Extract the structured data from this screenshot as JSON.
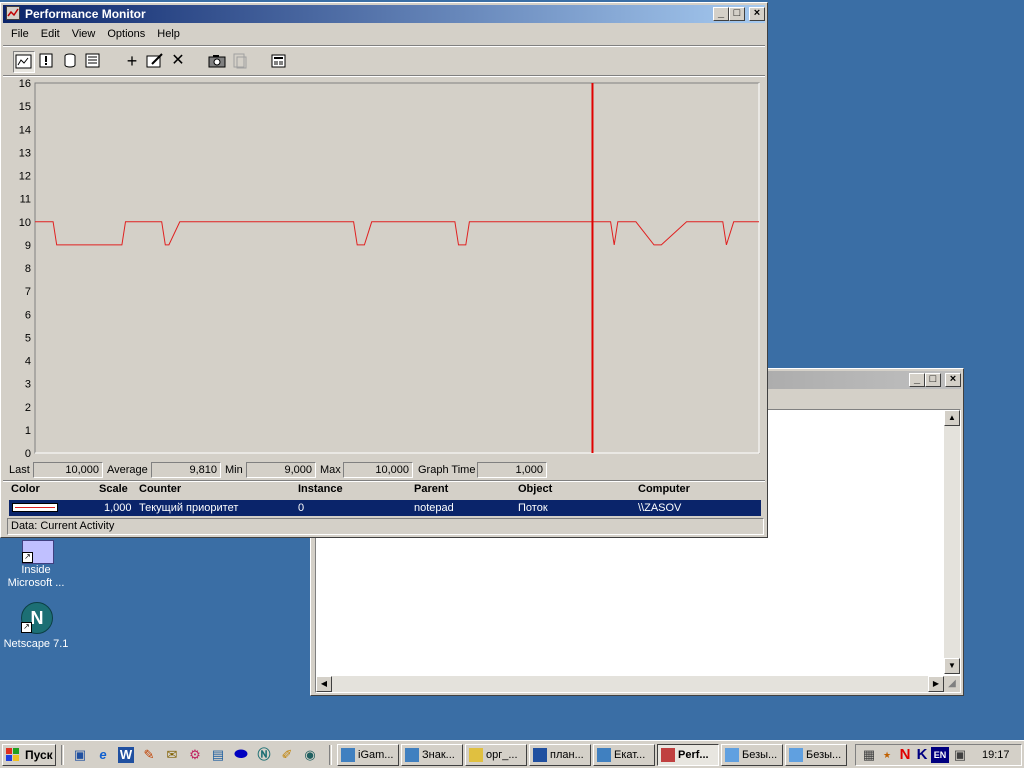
{
  "perfmon": {
    "title": "Performance Monitor",
    "menu": [
      "File",
      "Edit",
      "View",
      "Options",
      "Help"
    ],
    "toolbar_icons": [
      "chart-view-icon",
      "alert-view-icon",
      "log-view-icon",
      "report-view-icon",
      "add-counter-icon",
      "edit-counter-icon",
      "delete-counter-icon",
      "snapshot-icon",
      "update-data-icon",
      "options-icon"
    ],
    "stats": {
      "last_label": "Last",
      "last_value": "10,000",
      "avg_label": "Average",
      "avg_value": "9,810",
      "min_label": "Min",
      "min_value": "9,000",
      "max_label": "Max",
      "max_value": "10,000",
      "time_label": "Graph Time",
      "time_value": "1,000"
    },
    "legend_headers": {
      "color": "Color",
      "scale": "Scale",
      "counter": "Counter",
      "instance": "Instance",
      "parent": "Parent",
      "object": "Object",
      "computer": "Computer"
    },
    "legend_row": {
      "scale": "1,000",
      "counter": "Текущий приоритет",
      "instance": "0",
      "parent": "notepad",
      "object": "Поток",
      "computer": "\\\\ZASOV"
    },
    "status": "Data: Current Activity"
  },
  "chart_data": {
    "type": "line",
    "ylim": [
      0,
      16
    ],
    "yticks": [
      "0",
      "1",
      "2",
      "3",
      "4",
      "5",
      "6",
      "7",
      "8",
      "9",
      "10",
      "11",
      "12",
      "13",
      "14",
      "15",
      "16"
    ],
    "grid": false,
    "line_color": "#e02020",
    "time_bar_position": 0.77,
    "series": [
      {
        "x": [
          0,
          0.025,
          0.03,
          0.12,
          0.125,
          0.175,
          0.18,
          0.185,
          0.2,
          0.205,
          0.44,
          0.445,
          0.455,
          0.465,
          0.58,
          0.585,
          0.595,
          0.6,
          0.77,
          0.795,
          0.8,
          0.805,
          0.83,
          0.855,
          0.865,
          0.9,
          0.95,
          0.955,
          0.965,
          1.0
        ],
        "values": [
          10,
          10,
          9,
          9,
          10,
          10,
          9,
          9,
          10,
          10,
          10,
          9,
          9,
          10,
          10,
          9,
          9,
          10,
          10,
          10,
          9,
          10,
          10,
          9,
          9,
          10,
          10,
          9,
          10,
          10
        ]
      }
    ]
  },
  "notepad": {
    "title": ""
  },
  "desktop": {
    "icon1_label_line1": "Inside",
    "icon1_label_line2": "Microsoft ...",
    "icon2_label": "Netscape 7.1"
  },
  "taskbar": {
    "start_label": "Пуск",
    "tasks": [
      "iGam...",
      "Знак...",
      "орг_...",
      "план...",
      "Екат...",
      "Perf...",
      "Безы...",
      "Безы..."
    ],
    "active_task": 5,
    "lang": "EN",
    "clock": "19:17"
  },
  "colors": {
    "desktop": "#3a6ea5",
    "face": "#d4d0c8",
    "titlebar": "#0a246a",
    "line": "#e02020",
    "selection": "#0a246a"
  }
}
